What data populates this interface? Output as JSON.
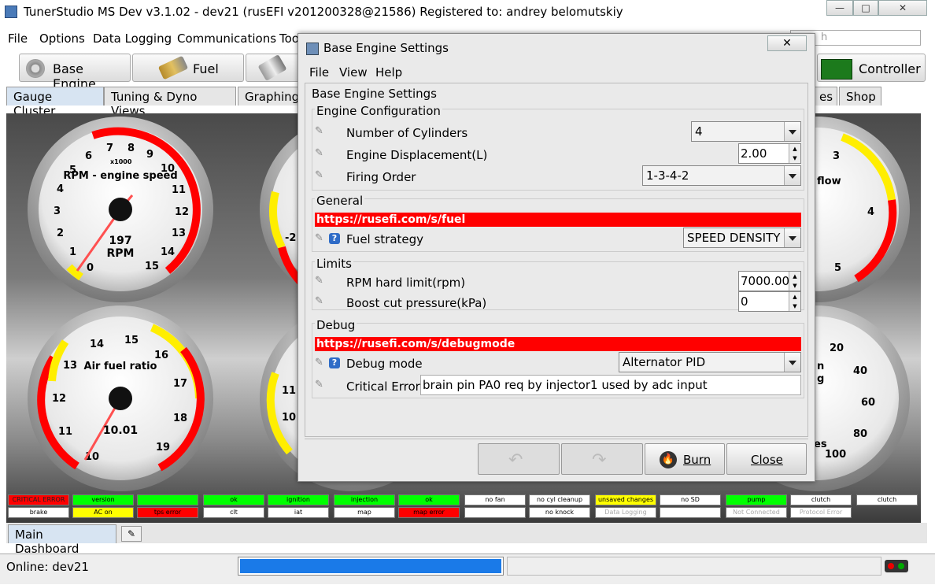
{
  "window": {
    "title": "TunerStudio MS Dev v3.1.02 - dev21 (rusEFI v201200328@21586) Registered to: andrey belomutskiy",
    "min": "—",
    "max": "□",
    "close": "✕"
  },
  "menu": {
    "file": "File",
    "options": "Options",
    "data_logging": "Data Logging",
    "communications": "Communications",
    "tools": "Too"
  },
  "search": {
    "placeholder": "h"
  },
  "toolbar": {
    "base_engine": "Base Engine",
    "fuel": "Fuel",
    "controller": "Controller"
  },
  "tabs": {
    "gauge_cluster": "Gauge Cluster",
    "tuning": "Tuning & Dyno Views",
    "graphing": "Graphing",
    "es": "es",
    "shop": "Shop"
  },
  "gauges": {
    "rpm": {
      "label": "RPM - engine speed",
      "x1000": "x1000",
      "value": "197",
      "unit": "RPM",
      "ticks": [
        "0",
        "1",
        "2",
        "3",
        "4",
        "5",
        "6",
        "7",
        "8",
        "9",
        "10",
        "11",
        "12",
        "13",
        "14",
        "15"
      ]
    },
    "afr": {
      "label": "Air fuel ratio",
      "value": "10.01",
      "ticks": [
        "10",
        "11",
        "12",
        "13",
        "14",
        "15",
        "16",
        "17",
        "18",
        "19"
      ]
    },
    "right_top": {
      "label": "flow",
      "ticks": [
        "3",
        "4",
        "5"
      ]
    },
    "right_bottom": {
      "label_a": "n",
      "label_b": "g",
      "label_c": "es",
      "ticks": [
        "20",
        "40",
        "60",
        "80",
        "100"
      ]
    },
    "mid_top": {
      "ticks": [
        "-2"
      ]
    },
    "mid_bottom": {
      "ticks": [
        "11",
        "10"
      ]
    }
  },
  "indicators": {
    "row1": [
      "CRITICAL ERROR",
      "version",
      "",
      "ok",
      "ignition",
      "injection",
      "ok",
      "no fan",
      "no cyl cleanup",
      "unsaved changes",
      "no SD",
      "pump",
      "clutch",
      "clutch"
    ],
    "row2": [
      "brake",
      "AC on",
      "tps error",
      "clt",
      "iat",
      "map",
      "map error",
      "",
      "no knock",
      "Data Logging",
      "",
      "Not Connected",
      "Protocol Error"
    ]
  },
  "bottom": {
    "main_dashboard": "Main Dashboard"
  },
  "status": {
    "online": "Online: dev21",
    "progress": 1.0
  },
  "dialog": {
    "title": "Base Engine Settings",
    "close": "✕",
    "menu": {
      "file": "File",
      "view": "View",
      "help": "Help"
    },
    "panel_title": "Base Engine Settings",
    "engine_config": {
      "title": "Engine Configuration",
      "cylinders_label": "Number of Cylinders",
      "cylinders_value": "4",
      "displacement_label": "Engine Displacement(L)",
      "displacement_value": "2.00",
      "firing_label": "Firing Order",
      "firing_value": "1-3-4-2"
    },
    "general": {
      "title": "General",
      "link": "https://rusefi.com/s/fuel",
      "fuel_strategy_label": "Fuel strategy",
      "fuel_strategy_value": "SPEED DENSITY"
    },
    "limits": {
      "title": "Limits",
      "rpm_label": "RPM hard limit(rpm)",
      "rpm_value": "7000.00",
      "boost_label": "Boost cut pressure(kPa)",
      "boost_value": "0"
    },
    "debug": {
      "title": "Debug",
      "link": "https://rusefi.com/s/debugmode",
      "mode_label": "Debug mode",
      "mode_value": "Alternator PID",
      "critical_label": "Critical Error",
      "critical_value": "brain pin PA0 req by injector1 used by adc input"
    },
    "buttons": {
      "burn": "Burn",
      "close": "Close"
    }
  },
  "colors": {
    "red": "#ff0000",
    "green": "#00ff00",
    "yellow": "#ffff00",
    "progress_blue": "#1a7ae8"
  }
}
